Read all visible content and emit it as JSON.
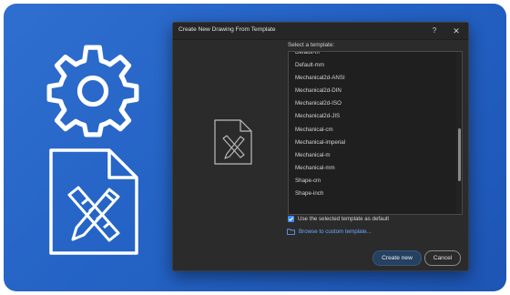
{
  "dialog": {
    "title": "Create New Drawing From Template",
    "help_label": "?",
    "close_label": "✕",
    "preview_icon": "drafting-file-icon"
  },
  "templates": {
    "label": "Select a template:",
    "items": [
      "Default-m",
      "Default-mm",
      "Mechanical2d-ANSI",
      "Mechanical2d-DIN",
      "Mechanical2d-ISO",
      "Mechanical2d-JIS",
      "Mechanical-cm",
      "Mechanical-imperial",
      "Mechanical-m",
      "Mechanical-mm",
      "Shape-cm",
      "Shape-inch"
    ]
  },
  "options": {
    "use_default_label": "Use the selected template as default",
    "use_default_checked": true,
    "browse_label": "Browse to custom template..."
  },
  "buttons": {
    "create_label": "Create new",
    "cancel_label": "Cancel"
  },
  "colors": {
    "background": "#2463c5",
    "dialog": "#2b2b2b",
    "accent": "#3d8bff",
    "link": "#6aa9ff"
  }
}
